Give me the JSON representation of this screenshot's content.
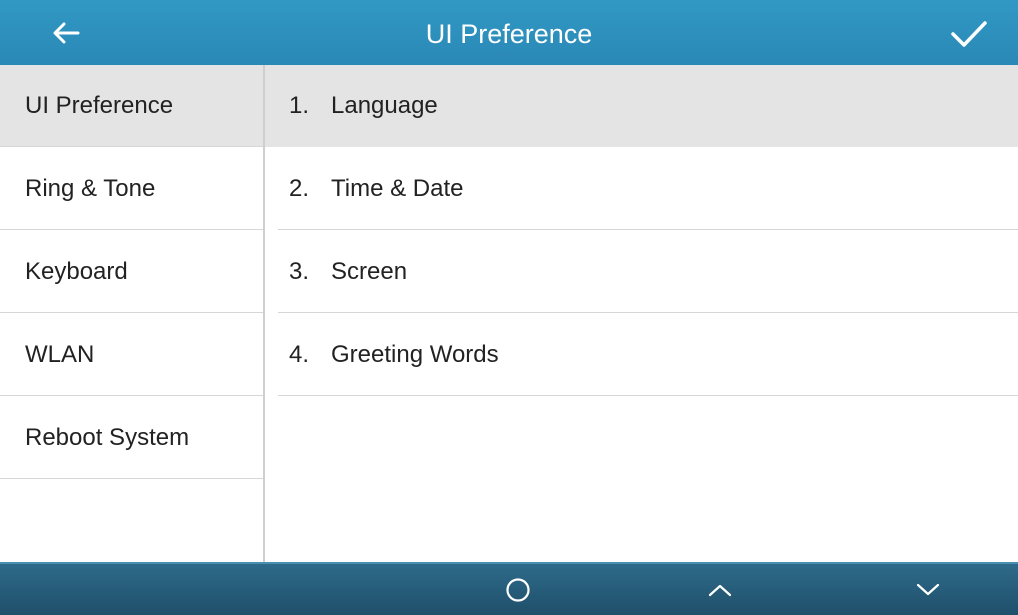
{
  "header": {
    "title": "UI Preference",
    "back_icon": "arrow-left-icon",
    "confirm_icon": "checkmark-icon"
  },
  "sidebar": {
    "selected_index": 0,
    "items": [
      {
        "label": "UI Preference"
      },
      {
        "label": "Ring & Tone"
      },
      {
        "label": "Keyboard"
      },
      {
        "label": "WLAN"
      },
      {
        "label": "Reboot System"
      }
    ]
  },
  "content": {
    "selected_index": 0,
    "items": [
      {
        "number": "1.",
        "label": "Language"
      },
      {
        "number": "2.",
        "label": "Time & Date"
      },
      {
        "number": "3.",
        "label": "Screen"
      },
      {
        "number": "4.",
        "label": "Greeting Words"
      }
    ]
  },
  "footer": {
    "softkeys": [
      "circle-icon",
      "chevron-up-icon",
      "chevron-down-icon"
    ]
  },
  "colors": {
    "header_bg": "#2f93c0",
    "footer_bg": "#245a77",
    "selected_bg": "#e4e4e4",
    "divider": "#d6d6d6",
    "text": "#222222"
  }
}
